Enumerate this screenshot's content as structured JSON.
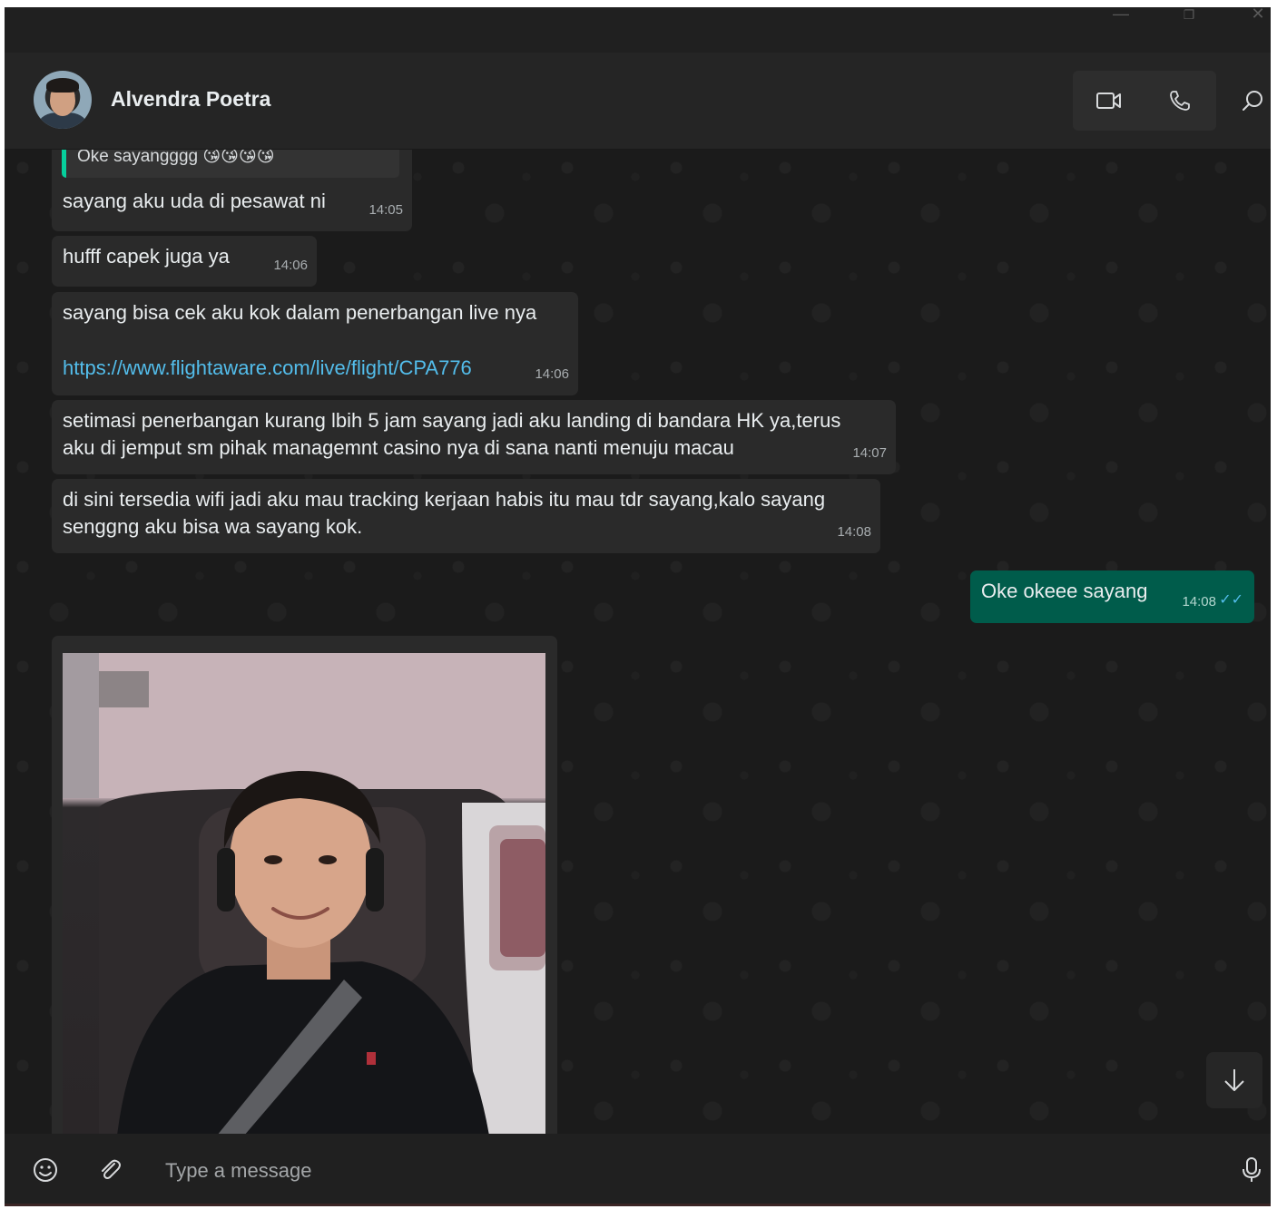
{
  "window": {
    "controls": {
      "minimize": "—",
      "restore": "❐",
      "close": "✕"
    }
  },
  "header": {
    "contact_name": "Alvendra Poetra",
    "icons": [
      "video-call-icon",
      "voice-call-icon",
      "search-icon"
    ]
  },
  "messages": [
    {
      "direction": "in",
      "quote": "Oke sayangggg 😘😘😘😘",
      "text": "sayang aku uda di pesawat ni",
      "time": "14:05"
    },
    {
      "direction": "in",
      "text": "hufff capek juga ya",
      "time": "14:06"
    },
    {
      "direction": "in",
      "text": "sayang bisa cek aku kok dalam penerbangan live nya",
      "link": "https://www.flightaware.com/live/flight/CPA776",
      "time": "14:06"
    },
    {
      "direction": "in",
      "text": "setimasi penerbangan kurang lbih 5 jam sayang jadi aku landing di bandara HK ya,terus aku di jemput sm pihak managemnt casino nya di sana nanti menuju macau",
      "time": "14:07"
    },
    {
      "direction": "in",
      "text": "di sini tersedia wifi jadi aku mau tracking kerjaan habis itu mau tdr sayang,kalo sayang senggng aku bisa wa sayang kok.",
      "time": "14:08"
    },
    {
      "direction": "out",
      "text": "Oke okeee sayang",
      "time": "14:08",
      "status": "read"
    },
    {
      "direction": "in",
      "type": "image"
    }
  ],
  "composer": {
    "placeholder": "Type a message",
    "icons": [
      "emoji-icon",
      "attach-icon",
      "microphone-icon"
    ]
  },
  "colors": {
    "incoming_bubble": "#2a2a2a",
    "outgoing_bubble": "#005c4b",
    "link": "#53bdeb",
    "quote_bar": "#06cf9c"
  }
}
